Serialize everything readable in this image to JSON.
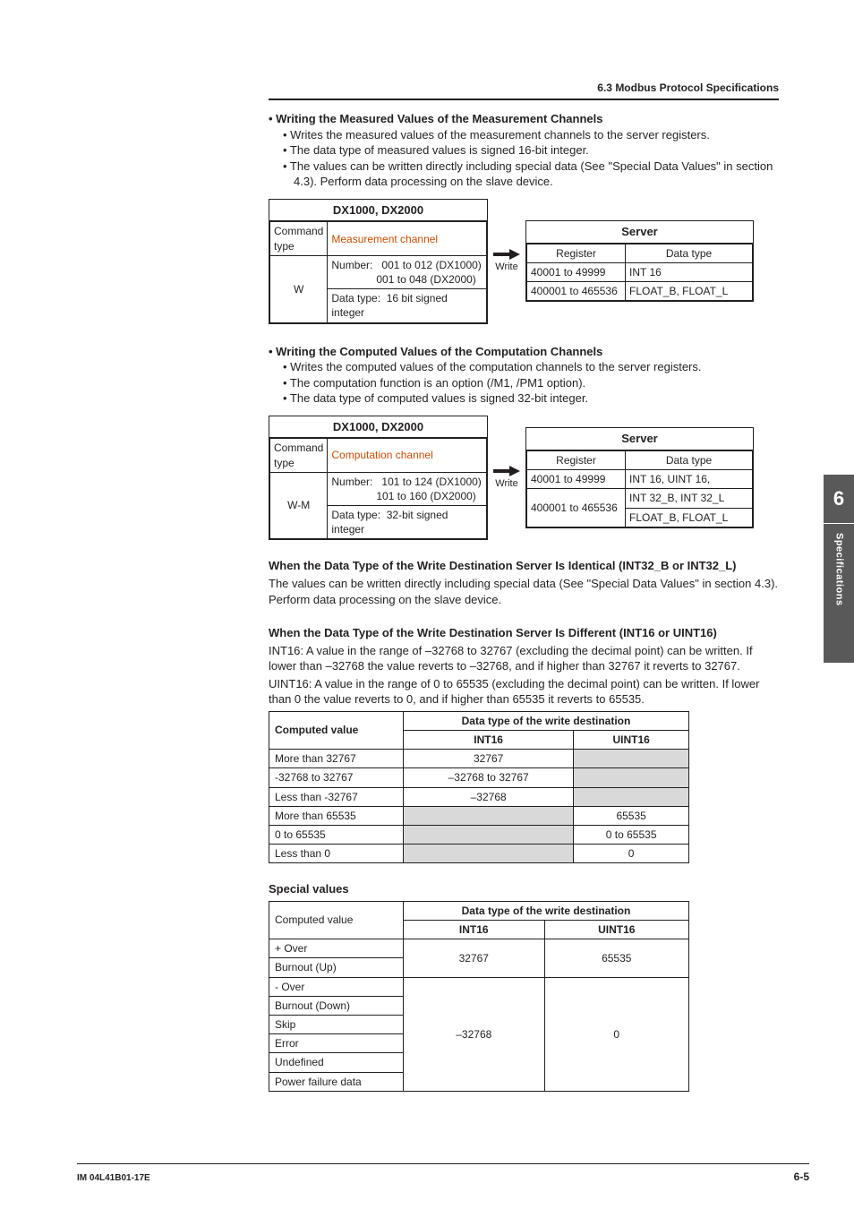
{
  "header": {
    "section": "6.3  Modbus Protocol Specifications"
  },
  "writing_measured": {
    "title": "•  Writing the Measured Values of the Measurement Channels",
    "b1": "•   Writes the measured values of the measurement channels to the server registers.",
    "b2": "•   The data type of measured values is signed 16-bit integer.",
    "b3": "•   The values can be written directly including special data (See \"Special Data Values\" in section 4.3). Perform data processing on the slave device."
  },
  "diag1": {
    "left_title": "DX1000, DX2000",
    "h1": "Command type",
    "h2": "Measurement channel",
    "cmd": "W",
    "numl": "Number:",
    "num1": "001 to 012 (DX1000)",
    "num2": "001 to 048 (DX2000)",
    "dtl": "Data type:",
    "dtv": "16 bit signed integer",
    "arrow": "Write",
    "right_title": "Server",
    "rh1": "Register",
    "rh2": "Data type",
    "r1a": "40001 to 49999",
    "r1b": "INT 16",
    "r2a": "400001 to 465536",
    "r2b": "FLOAT_B, FLOAT_L"
  },
  "writing_computed": {
    "title": "•  Writing the Computed Values of the Computation Channels",
    "b1": "•   Writes the computed values of the computation channels to the server registers.",
    "b2": "•   The computation function is an option (/M1, /PM1 option).",
    "b3": "•   The data type of computed values is signed 32-bit integer."
  },
  "diag2": {
    "left_title": "DX1000, DX2000",
    "h1": "Command type",
    "h2": "Computation channel",
    "cmd": "W-M",
    "numl": "Number:",
    "num1": "101 to 124 (DX1000)",
    "num2": "101 to 160 (DX2000)",
    "dtl": "Data type:",
    "dtv": "32-bit signed integer",
    "arrow": "Write",
    "right_title": "Server",
    "rh1": "Register",
    "rh2": "Data type",
    "r1a": "40001 to 49999",
    "r1b": "INT 16, UINT 16,",
    "r2a": "400001 to 465536",
    "r2b": "INT 32_B, INT 32_L",
    "r2c": "FLOAT_B, FLOAT_L"
  },
  "identical": {
    "title": "When the Data Type of the Write Destination Server Is Identical (INT32_B or INT32_L)",
    "p": "The values can be written directly including special data (See \"Special Data Values\" in section 4.3). Perform data processing on the slave device."
  },
  "different": {
    "title": "When the Data Type of the Write Destination Server Is Different (INT16 or UINT16)",
    "p1": "INT16: A value in the range of –32768 to 32767 (excluding the decimal point) can be written. If lower than –32768 the value reverts to –32768, and if higher than 32767 it reverts to 32767.",
    "p2": "UINT16: A value in the range of 0 to 65535 (excluding the decimal point) can be written. If lower than 0 the value reverts to 0, and if higher than 65535 it reverts to 65535."
  },
  "table1": {
    "h0": "Computed value",
    "hspan": "Data type of the write destination",
    "h1": "INT16",
    "h2": "UINT16",
    "rows": [
      {
        "a": "More than 32767",
        "b": "32767",
        "c": ""
      },
      {
        "a": "-32768 to 32767",
        "b": "–32768 to 32767",
        "c": ""
      },
      {
        "a": "Less than -32767",
        "b": "–32768",
        "c": ""
      },
      {
        "a": "More than 65535",
        "b": "",
        "c": "65535"
      },
      {
        "a": "0 to 65535",
        "b": "",
        "c": "0 to 65535"
      },
      {
        "a": "Less than 0",
        "b": "",
        "c": "0"
      }
    ]
  },
  "special": {
    "title": "Special values",
    "h0": "Computed value",
    "hspan": "Data type of the write destination",
    "h1": "INT16",
    "h2": "UINT16",
    "r1a": "+ Over",
    "r1b": "Burnout (Up)",
    "r1int": "32767",
    "r1uint": "65535",
    "r2a": "- Over",
    "r2b": "Burnout (Down)",
    "r2c": "Skip",
    "r2d": "Error",
    "r2e": "Undefined",
    "r2f": "Power failure data",
    "r2int": "–32768",
    "r2uint": "0"
  },
  "sidetab": {
    "chapter": "6",
    "label": "Specifications"
  },
  "footer": {
    "left": "IM 04L41B01-17E",
    "right": "6-5"
  }
}
